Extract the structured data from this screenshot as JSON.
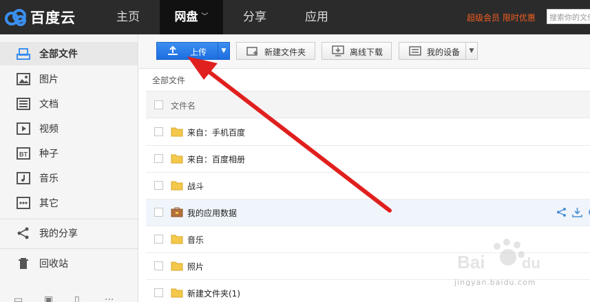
{
  "app": {
    "logo_text": "百度云"
  },
  "nav": {
    "items": [
      {
        "label": "主页"
      },
      {
        "label": "网盘",
        "active": true
      },
      {
        "label": "分享"
      },
      {
        "label": "应用"
      }
    ],
    "promo": "超级会员 限时优惠",
    "search_placeholder": "搜索你的文件"
  },
  "sidebar": {
    "items": [
      {
        "label": "全部文件",
        "icon": "all-files-icon",
        "active": true
      },
      {
        "label": "图片",
        "icon": "image-icon"
      },
      {
        "label": "文档",
        "icon": "document-icon"
      },
      {
        "label": "视频",
        "icon": "video-icon"
      },
      {
        "label": "种子",
        "icon": "bt-icon",
        "icon_text": "BT"
      },
      {
        "label": "音乐",
        "icon": "music-icon"
      },
      {
        "label": "其它",
        "icon": "other-icon"
      },
      {
        "label": "我的分享",
        "icon": "share-icon"
      },
      {
        "label": "回收站",
        "icon": "trash-icon"
      }
    ]
  },
  "toolbar": {
    "upload_label": "上传",
    "newfolder_label": "新建文件夹",
    "offline_label": "离线下载",
    "device_label": "我的设备"
  },
  "breadcrumb": "全部文件",
  "list": {
    "header_name": "文件名",
    "rows": [
      {
        "name": "来自：手机百度",
        "type": "folder"
      },
      {
        "name": "来自：百度相册",
        "type": "folder"
      },
      {
        "name": "战斗",
        "type": "folder"
      },
      {
        "name": "我的应用数据",
        "type": "app-folder",
        "highlighted": true
      },
      {
        "name": "音乐",
        "type": "folder"
      },
      {
        "name": "照片",
        "type": "folder"
      },
      {
        "name": "新建文件夹(1)",
        "type": "folder"
      }
    ]
  },
  "watermark": {
    "text": "jingyan.baidu.com"
  },
  "colors": {
    "topbar": "#2b2b2b",
    "accent": "#1d6ee0",
    "promo": "#f25d23",
    "arrow": "#e0201e",
    "folder": "#f3c84b"
  }
}
